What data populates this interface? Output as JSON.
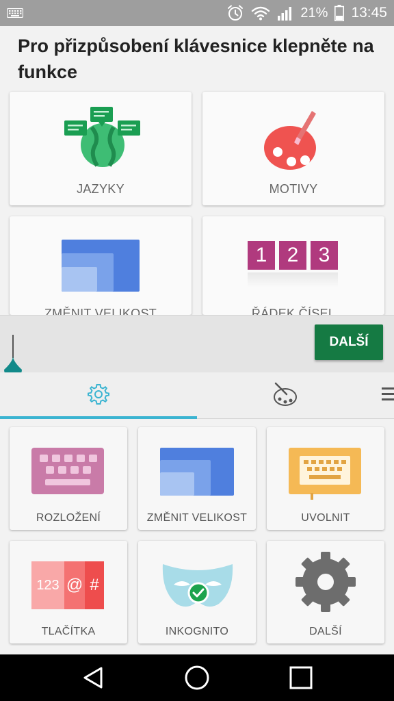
{
  "status_bar": {
    "battery_percent": "21%",
    "time": "13:45",
    "icons": [
      "keyboard-icon",
      "alarm-icon",
      "wifi-icon",
      "signal-icon",
      "battery-icon"
    ]
  },
  "title": "Pro přizpůsobení klávesnice klepněte na funkce",
  "feature_cards": [
    {
      "label": "JAZYKY",
      "icon": "languages-globe-icon"
    },
    {
      "label": "MOTIVY",
      "icon": "palette-icon"
    },
    {
      "label": "ZMĚNIT VELIKOST",
      "icon": "resize-icon"
    },
    {
      "label": "ŘÁDEK ČÍSEL",
      "icon": "number-row-icon"
    }
  ],
  "number_row_digits": [
    "1",
    "2",
    "3"
  ],
  "next_button": "DALŠÍ",
  "toolbar_tabs": [
    {
      "icon": "gear-icon",
      "active": true
    },
    {
      "icon": "palette-icon",
      "active": false
    },
    {
      "icon": "menu-icon",
      "active": false
    }
  ],
  "toolbar_tiles": [
    {
      "label": "ROZLOŽENÍ",
      "icon": "layout-keyboard-icon"
    },
    {
      "label": "ZMĚNIT VELIKOST",
      "icon": "resize-icon"
    },
    {
      "label": "UVOLNIT",
      "icon": "undock-keyboard-icon"
    },
    {
      "label": "TLAČÍTKA",
      "icon": "keys-icon"
    },
    {
      "label": "INKOGNITO",
      "icon": "incognito-mask-icon"
    },
    {
      "label": "DALŠÍ",
      "icon": "settings-gear-icon"
    }
  ],
  "keys_tile_text": {
    "digits": "123",
    "at": "@",
    "hash": "#"
  },
  "colors": {
    "accent_green": "#157a43",
    "tab_indicator": "#3bb4d1",
    "cursor_teal": "#128a8a",
    "status_bar": "#9e9e9e"
  },
  "nav_bar": [
    "back-icon",
    "home-icon",
    "recents-icon"
  ]
}
